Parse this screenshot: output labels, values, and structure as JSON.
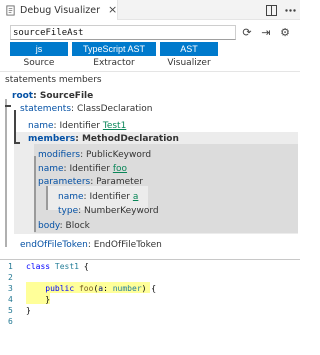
{
  "tab": {
    "title": "Debug Visualizer",
    "close": "×"
  },
  "tab_actions": [
    "split-icon",
    "more-icon"
  ],
  "search": {
    "value": "sourceFileAst",
    "placeholder": ""
  },
  "actions": {
    "refresh": "⟳",
    "export": "⇥",
    "settings": "⚙"
  },
  "selectors": [
    {
      "value": "js",
      "label": "Source"
    },
    {
      "value": "TypeScript AST",
      "label": "Extractor"
    },
    {
      "value": "AST",
      "label": "Visualizer"
    }
  ],
  "section_header": "statements members",
  "tree": {
    "root": {
      "key": "root",
      "val": "SourceFile"
    },
    "statements": {
      "key": "statements",
      "val": "ClassDeclaration"
    },
    "name1": {
      "key": "name",
      "val": "Identifier",
      "link": "Test1"
    },
    "members": {
      "key": "members",
      "val": "MethodDeclaration"
    },
    "modifiers": {
      "key": "modifiers",
      "val": "PublicKeyword"
    },
    "name2": {
      "key": "name",
      "val": "Identifier",
      "link": "foo"
    },
    "parameters": {
      "key": "parameters",
      "val": "Parameter"
    },
    "name3": {
      "key": "name",
      "val": "Identifier",
      "link": "a"
    },
    "type": {
      "key": "type",
      "val": "NumberKeyword"
    },
    "body": {
      "key": "body",
      "val": "Block"
    },
    "eof": {
      "key": "endOfFileToken",
      "val": "EndOfFileToken"
    }
  },
  "editor": {
    "line_numbers": [
      "1",
      "2",
      "3",
      "4",
      "5",
      "6"
    ],
    "lines": [
      {
        "kw": "class",
        "ty": " Test1",
        "rest": " {"
      },
      {
        "rest": ""
      },
      {
        "indent": "    ",
        "kw": "public",
        "fn": " foo",
        "p1": "(",
        "pm": "a",
        "p2": ": ",
        "ty": "number",
        "rest": ") {"
      },
      {
        "indent": "    ",
        "rest": "}"
      },
      {
        "rest": "}"
      },
      {
        "rest": ""
      }
    ]
  }
}
